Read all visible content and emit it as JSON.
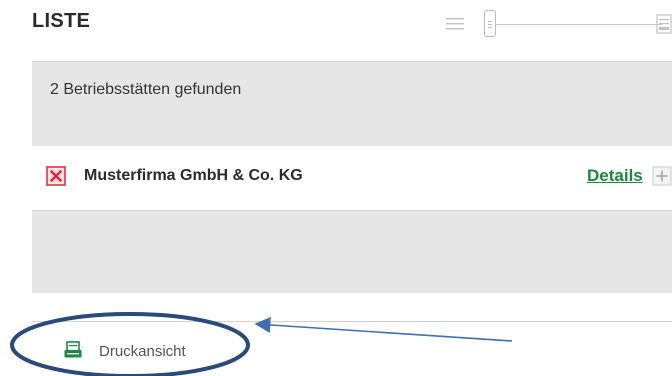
{
  "header": {
    "title": "LISTE",
    "view_slider": {
      "left_icon": "list-icon",
      "right_icon": "tile-icon",
      "position": 0
    }
  },
  "results": {
    "count_text": "2 Betriebsstätten gefunden",
    "items": [
      {
        "name": "Musterfirma GmbH & Co. KG",
        "details_label": "Details",
        "remove_icon": "close-box-icon",
        "expand_icon": "plus-box-icon"
      }
    ]
  },
  "footer": {
    "print_label": "Druckansicht",
    "print_icon": "printer-icon"
  },
  "colors": {
    "link_green": "#1a8a3c",
    "remove_red": "#e0263c",
    "panel_gray": "#e6e6e6",
    "annotation_blue": "#2a4a7a"
  }
}
